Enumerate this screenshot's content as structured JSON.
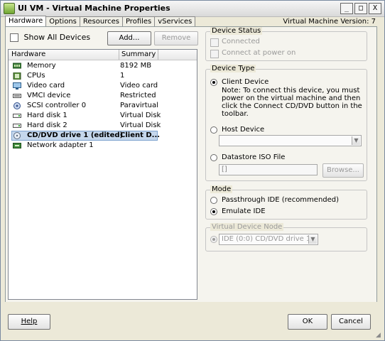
{
  "window": {
    "title": "UI VM - Virtual Machine Properties",
    "controls": [
      "_",
      "□",
      "X"
    ],
    "version_label": "Virtual Machine Version: 7"
  },
  "tabs": [
    {
      "label": "Hardware",
      "active": true
    },
    {
      "label": "Options"
    },
    {
      "label": "Resources"
    },
    {
      "label": "Profiles"
    },
    {
      "label": "vServices"
    }
  ],
  "hardware_panel": {
    "show_all_devices": "Show All Devices",
    "add_label": "Add...",
    "remove_label": "Remove",
    "columns": [
      "Hardware",
      "Summary"
    ],
    "rows": [
      {
        "icon": "memory-icon",
        "name": "Memory",
        "summary": "8192 MB"
      },
      {
        "icon": "cpu-icon",
        "name": "CPUs",
        "summary": "1"
      },
      {
        "icon": "monitor-icon",
        "name": "Video card",
        "summary": "Video card"
      },
      {
        "icon": "vmci-icon",
        "name": "VMCI device",
        "summary": "Restricted"
      },
      {
        "icon": "scsi-icon",
        "name": "SCSI controller 0",
        "summary": "Paravirtual"
      },
      {
        "icon": "disk-icon",
        "name": "Hard disk 1",
        "summary": "Virtual Disk"
      },
      {
        "icon": "disk-icon",
        "name": "Hard disk 2",
        "summary": "Virtual Disk"
      },
      {
        "icon": "cdrom-icon",
        "name": "CD/DVD drive 1 (edited)",
        "summary": "Client D...",
        "selected": true
      },
      {
        "icon": "network-icon",
        "name": "Network adapter 1",
        "summary": ""
      }
    ]
  },
  "device_status": {
    "legend": "Device Status",
    "connected": "Connected",
    "connect_at_power_on": "Connect at power on"
  },
  "device_type": {
    "legend": "Device Type",
    "client_device": "Client Device",
    "note": "Note: To connect this device, you must power on the virtual machine and then click the Connect CD/DVD button in the toolbar.",
    "host_device": "Host Device",
    "datastore_iso": "Datastore ISO File",
    "iso_value": "[]",
    "browse": "Browse..."
  },
  "mode": {
    "legend": "Mode",
    "passthrough": "Passthrough IDE (recommended)",
    "emulate": "Emulate IDE"
  },
  "virtual_device_node": {
    "legend": "Virtual Device Node",
    "value": "IDE (0:0) CD/DVD drive 1"
  },
  "footer": {
    "help": "Help",
    "ok": "OK",
    "cancel": "Cancel"
  }
}
